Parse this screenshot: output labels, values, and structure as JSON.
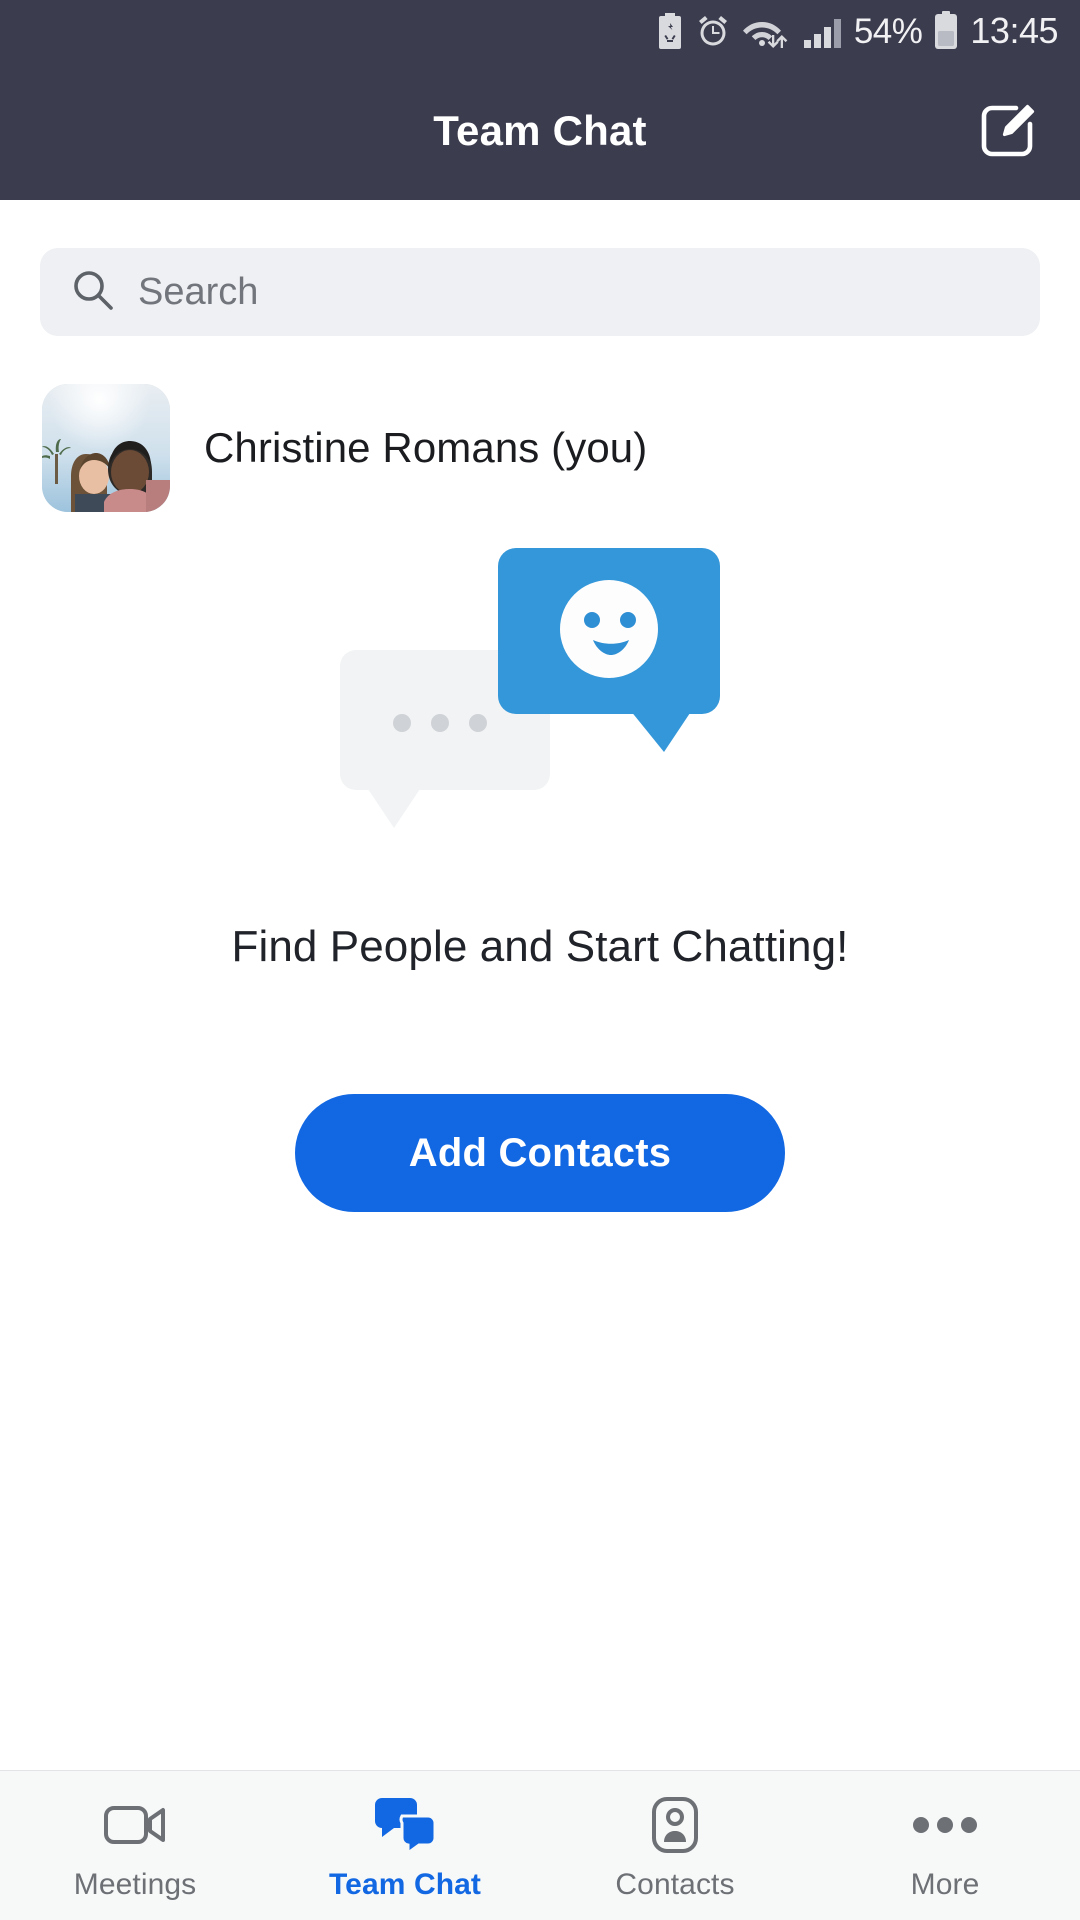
{
  "status_bar": {
    "battery_percent": "54%",
    "time": "13:45",
    "icons": [
      "battery-saver-icon",
      "alarm-icon",
      "wifi-icon",
      "cellular-signal-icon",
      "battery-icon"
    ],
    "background_color": "#3b3c4e",
    "text_color": "#f1f1f4"
  },
  "nav_bar": {
    "title": "Team Chat",
    "compose_icon": "compose-pencil-icon",
    "background_color": "#3b3c4e"
  },
  "search": {
    "placeholder": "Search",
    "value": "",
    "icon": "search-icon",
    "background_color": "#eef0f3"
  },
  "contact": {
    "name": "Christine Romans (you)",
    "avatar": "user-avatar-photo"
  },
  "empty_state": {
    "illustration": "chat-bubbles-illustration",
    "title": "Find People and Start Chatting!",
    "button_label": "Add Contacts",
    "button_color": "#1268e3",
    "bubble_blue": "#3497d9",
    "bubble_gray": "#f2f3f4",
    "dots_color": "#cfd2d6"
  },
  "tab_bar": {
    "active_color": "#1268e3",
    "inactive_color": "#6d7075",
    "background_color": "#f7f8f8",
    "tabs": [
      {
        "label": "Meetings",
        "icon": "video-camera-icon",
        "active": false
      },
      {
        "label": "Team Chat",
        "icon": "chat-bubbles-icon",
        "active": true
      },
      {
        "label": "Contacts",
        "icon": "contact-card-icon",
        "active": false
      },
      {
        "label": "More",
        "icon": "more-dots-icon",
        "active": false
      }
    ]
  }
}
